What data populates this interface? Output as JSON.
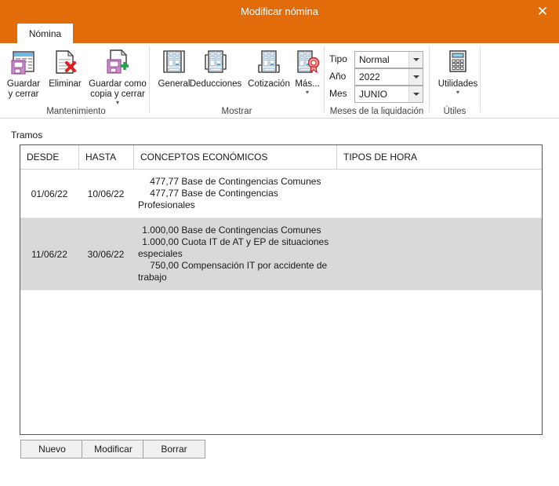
{
  "window": {
    "title": "Modificar nómina",
    "close_label": "✕",
    "accent_color": "#e36c0a"
  },
  "tabs": [
    {
      "label": "Nómina",
      "active": true
    }
  ],
  "ribbon": {
    "groups": [
      {
        "name": "mantenimiento",
        "label": "Mantenimiento",
        "buttons": [
          {
            "name": "guardar-y-cerrar",
            "label": "Guardar\ny cerrar",
            "icon": "save-table-icon",
            "has_caret": false
          },
          {
            "name": "eliminar",
            "label": "Eliminar",
            "icon": "delete-document-icon",
            "has_caret": false
          },
          {
            "name": "guardar-como-copia-y-cerrar",
            "label": "Guardar como\ncopia y cerrar",
            "icon": "save-copy-icon",
            "has_caret": true
          }
        ]
      },
      {
        "name": "mostrar",
        "label": "Mostrar",
        "buttons": [
          {
            "name": "general",
            "label": "General",
            "icon": "document-general-icon",
            "has_caret": false
          },
          {
            "name": "deducciones",
            "label": "Deducciones",
            "icon": "document-deducciones-icon",
            "has_caret": false
          },
          {
            "name": "cotizacion",
            "label": "Cotización",
            "icon": "document-cotizacion-icon",
            "has_caret": false
          },
          {
            "name": "mas",
            "label": "Más...",
            "icon": "document-seal-icon",
            "has_caret": true
          }
        ]
      },
      {
        "name": "meses-liquidacion",
        "label": "Meses de la liquidación",
        "fields": [
          {
            "name": "tipo",
            "label": "Tipo",
            "value": "Normal"
          },
          {
            "name": "ano",
            "label": "Año",
            "value": "2022"
          },
          {
            "name": "mes",
            "label": "Mes",
            "value": "JUNIO"
          }
        ]
      },
      {
        "name": "utiles",
        "label": "Útiles",
        "buttons": [
          {
            "name": "utilidades",
            "label": "Utilidades",
            "icon": "calculator-icon",
            "has_caret": true
          }
        ]
      }
    ]
  },
  "main": {
    "section_label": "Tramos",
    "table": {
      "columns": [
        "DESDE",
        "HASTA",
        "CONCEPTOS ECONÓMICOS",
        "TIPOS DE HORA"
      ],
      "rows": [
        {
          "selected": false,
          "desde": "01/06/22",
          "hasta": "10/06/22",
          "conceptos": [
            {
              "amount": "477,77",
              "text": "Base de Contingencias Comunes"
            },
            {
              "amount": "477,77",
              "text": "Base de Contingencias Profesionales"
            }
          ],
          "tipos_de_hora": ""
        },
        {
          "selected": true,
          "desde": "11/06/22",
          "hasta": "30/06/22",
          "conceptos": [
            {
              "amount": "1.000,00",
              "text": "Base de Contingencias Comunes"
            },
            {
              "amount": "1.000,00",
              "text": "Cuota IT de AT y EP de situaciones especiales"
            },
            {
              "amount": "750,00",
              "text": "Compensación IT por accidente de trabajo"
            }
          ],
          "tipos_de_hora": ""
        }
      ]
    },
    "actions": [
      {
        "name": "nuevo",
        "label": "Nuevo"
      },
      {
        "name": "modificar",
        "label": "Modificar"
      },
      {
        "name": "borrar",
        "label": "Borrar"
      }
    ]
  }
}
